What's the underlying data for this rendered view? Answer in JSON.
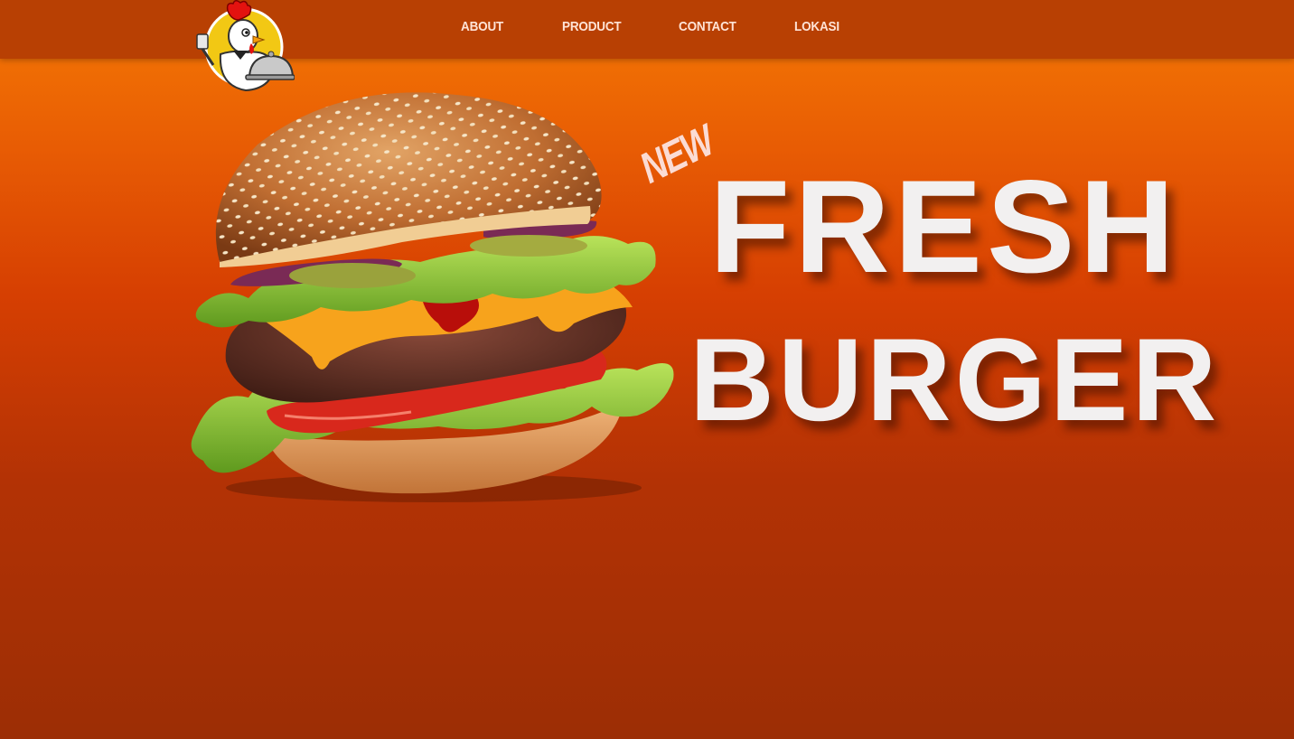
{
  "nav": {
    "items": [
      {
        "label": "ABOUT"
      },
      {
        "label": "PRODUCT"
      },
      {
        "label": "CONTACT"
      },
      {
        "label": "LOKASI"
      }
    ]
  },
  "brand": {
    "logo_icon": "chef-chicken-logo-icon"
  },
  "hero": {
    "tag": "NEW",
    "line1": "FRESH",
    "line2": "BURGER",
    "image_icon": "burger-image"
  },
  "colors": {
    "navbar": "#b84003",
    "gradient_top": "#f57a05",
    "gradient_bottom": "#9c2e05",
    "headline": "#f2f0f0",
    "tag": "#fbdcd4"
  }
}
